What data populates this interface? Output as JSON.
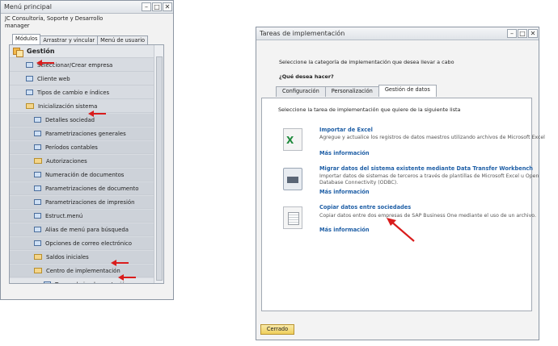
{
  "main_menu": {
    "title": "Menú principal",
    "company": "JC Consultoría, Soporte y Desarrollo",
    "user": "manager",
    "tabs": [
      "Módulos",
      "Arrastrar y vincular",
      "Menú de usuario"
    ],
    "tree": [
      {
        "label": "Gestión",
        "type": "module",
        "level": 0
      },
      {
        "label": "Seleccionar/Crear empresa",
        "type": "item",
        "level": 1
      },
      {
        "label": "Cliente web",
        "type": "item",
        "level": 1
      },
      {
        "label": "Tipos de cambio e índices",
        "type": "item",
        "level": 1
      },
      {
        "label": "Inicialización sistema",
        "type": "folder",
        "level": 1
      },
      {
        "label": "Detalles sociedad",
        "type": "item",
        "level": 2
      },
      {
        "label": "Parametrizaciones generales",
        "type": "item",
        "level": 2
      },
      {
        "label": "Períodos contables",
        "type": "item",
        "level": 2
      },
      {
        "label": "Autorizaciones",
        "type": "folder",
        "level": 2
      },
      {
        "label": "Numeración de documentos",
        "type": "item",
        "level": 2
      },
      {
        "label": "Parametrizaciones de documento",
        "type": "item",
        "level": 2
      },
      {
        "label": "Parametrizaciones de impresión",
        "type": "item",
        "level": 2
      },
      {
        "label": "Estruct.menú",
        "type": "item",
        "level": 2
      },
      {
        "label": "Alias de menú para búsqueda",
        "type": "item",
        "level": 2
      },
      {
        "label": "Opciones de correo electrónico",
        "type": "item",
        "level": 2
      },
      {
        "label": "Saldos iniciales",
        "type": "folder",
        "level": 2
      },
      {
        "label": "Centro de implementación",
        "type": "folder",
        "level": 2
      },
      {
        "label": "Tareas de implementación",
        "type": "item",
        "level": 3
      }
    ]
  },
  "impl_window": {
    "title": "Tareas de implementación",
    "intro": "Seleccione la categoría de implementación que desea llevar a cabo",
    "question": "¿Qué desea hacer?",
    "tabs": [
      "Configuración",
      "Personalización",
      "Gestión de datos"
    ],
    "active_tab": "Gestión de datos",
    "panel_intro": "Seleccione la tarea de implementación que quiere de la siguiente lista",
    "tasks": [
      {
        "title": "Importar de Excel",
        "desc1": "Agregue y actualice los registros de datos maestros utilizando archivos de Microsoft Excel",
        "desc2": "",
        "link": "Más información",
        "icon": "excel-icon"
      },
      {
        "title": "Migrar datos del sistema existente mediante Data Transfer Workbench",
        "desc1": "Importar datos de sistemas de terceros a través de plantillas de Microsoft Excel u Open",
        "desc2": "Database Connectivity (ODBC).",
        "link": "Más información",
        "icon": "workbench-icon"
      },
      {
        "title": "Copiar datos entre sociedades",
        "desc1": "Copiar datos entre dos empresas de SAP Business One mediante el uso de un archivo.",
        "desc2": "",
        "link": "Más información",
        "icon": "copy-documents-icon"
      }
    ],
    "close_button": "Cerrado"
  },
  "colors": {
    "accent_link": "#1f5fa6",
    "annotation_arrow": "#d91c1c",
    "button_yellow": "#efcf5b"
  }
}
